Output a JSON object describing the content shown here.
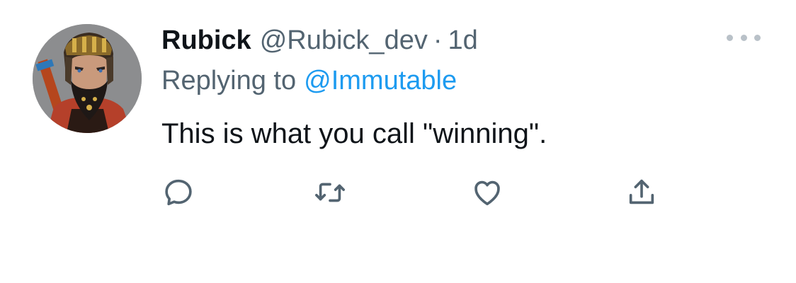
{
  "tweet": {
    "display_name": "Rubick",
    "handle": "@Rubick_dev",
    "separator": "·",
    "age": "1d",
    "reply_prefix": "Replying to",
    "reply_to": "@Immutable",
    "text": "This is what you call \"winning\"."
  },
  "icons": {
    "avatar": "avatar-warrior-character",
    "more": "more-horizontal-icon",
    "reply": "reply-icon",
    "retweet": "retweet-icon",
    "like": "like-icon",
    "share": "share-icon"
  },
  "colors": {
    "name": "#0f1419",
    "secondary": "#536471",
    "link": "#1d9bf0",
    "icon": "#536471",
    "more_dots": "#b9c1c8"
  }
}
